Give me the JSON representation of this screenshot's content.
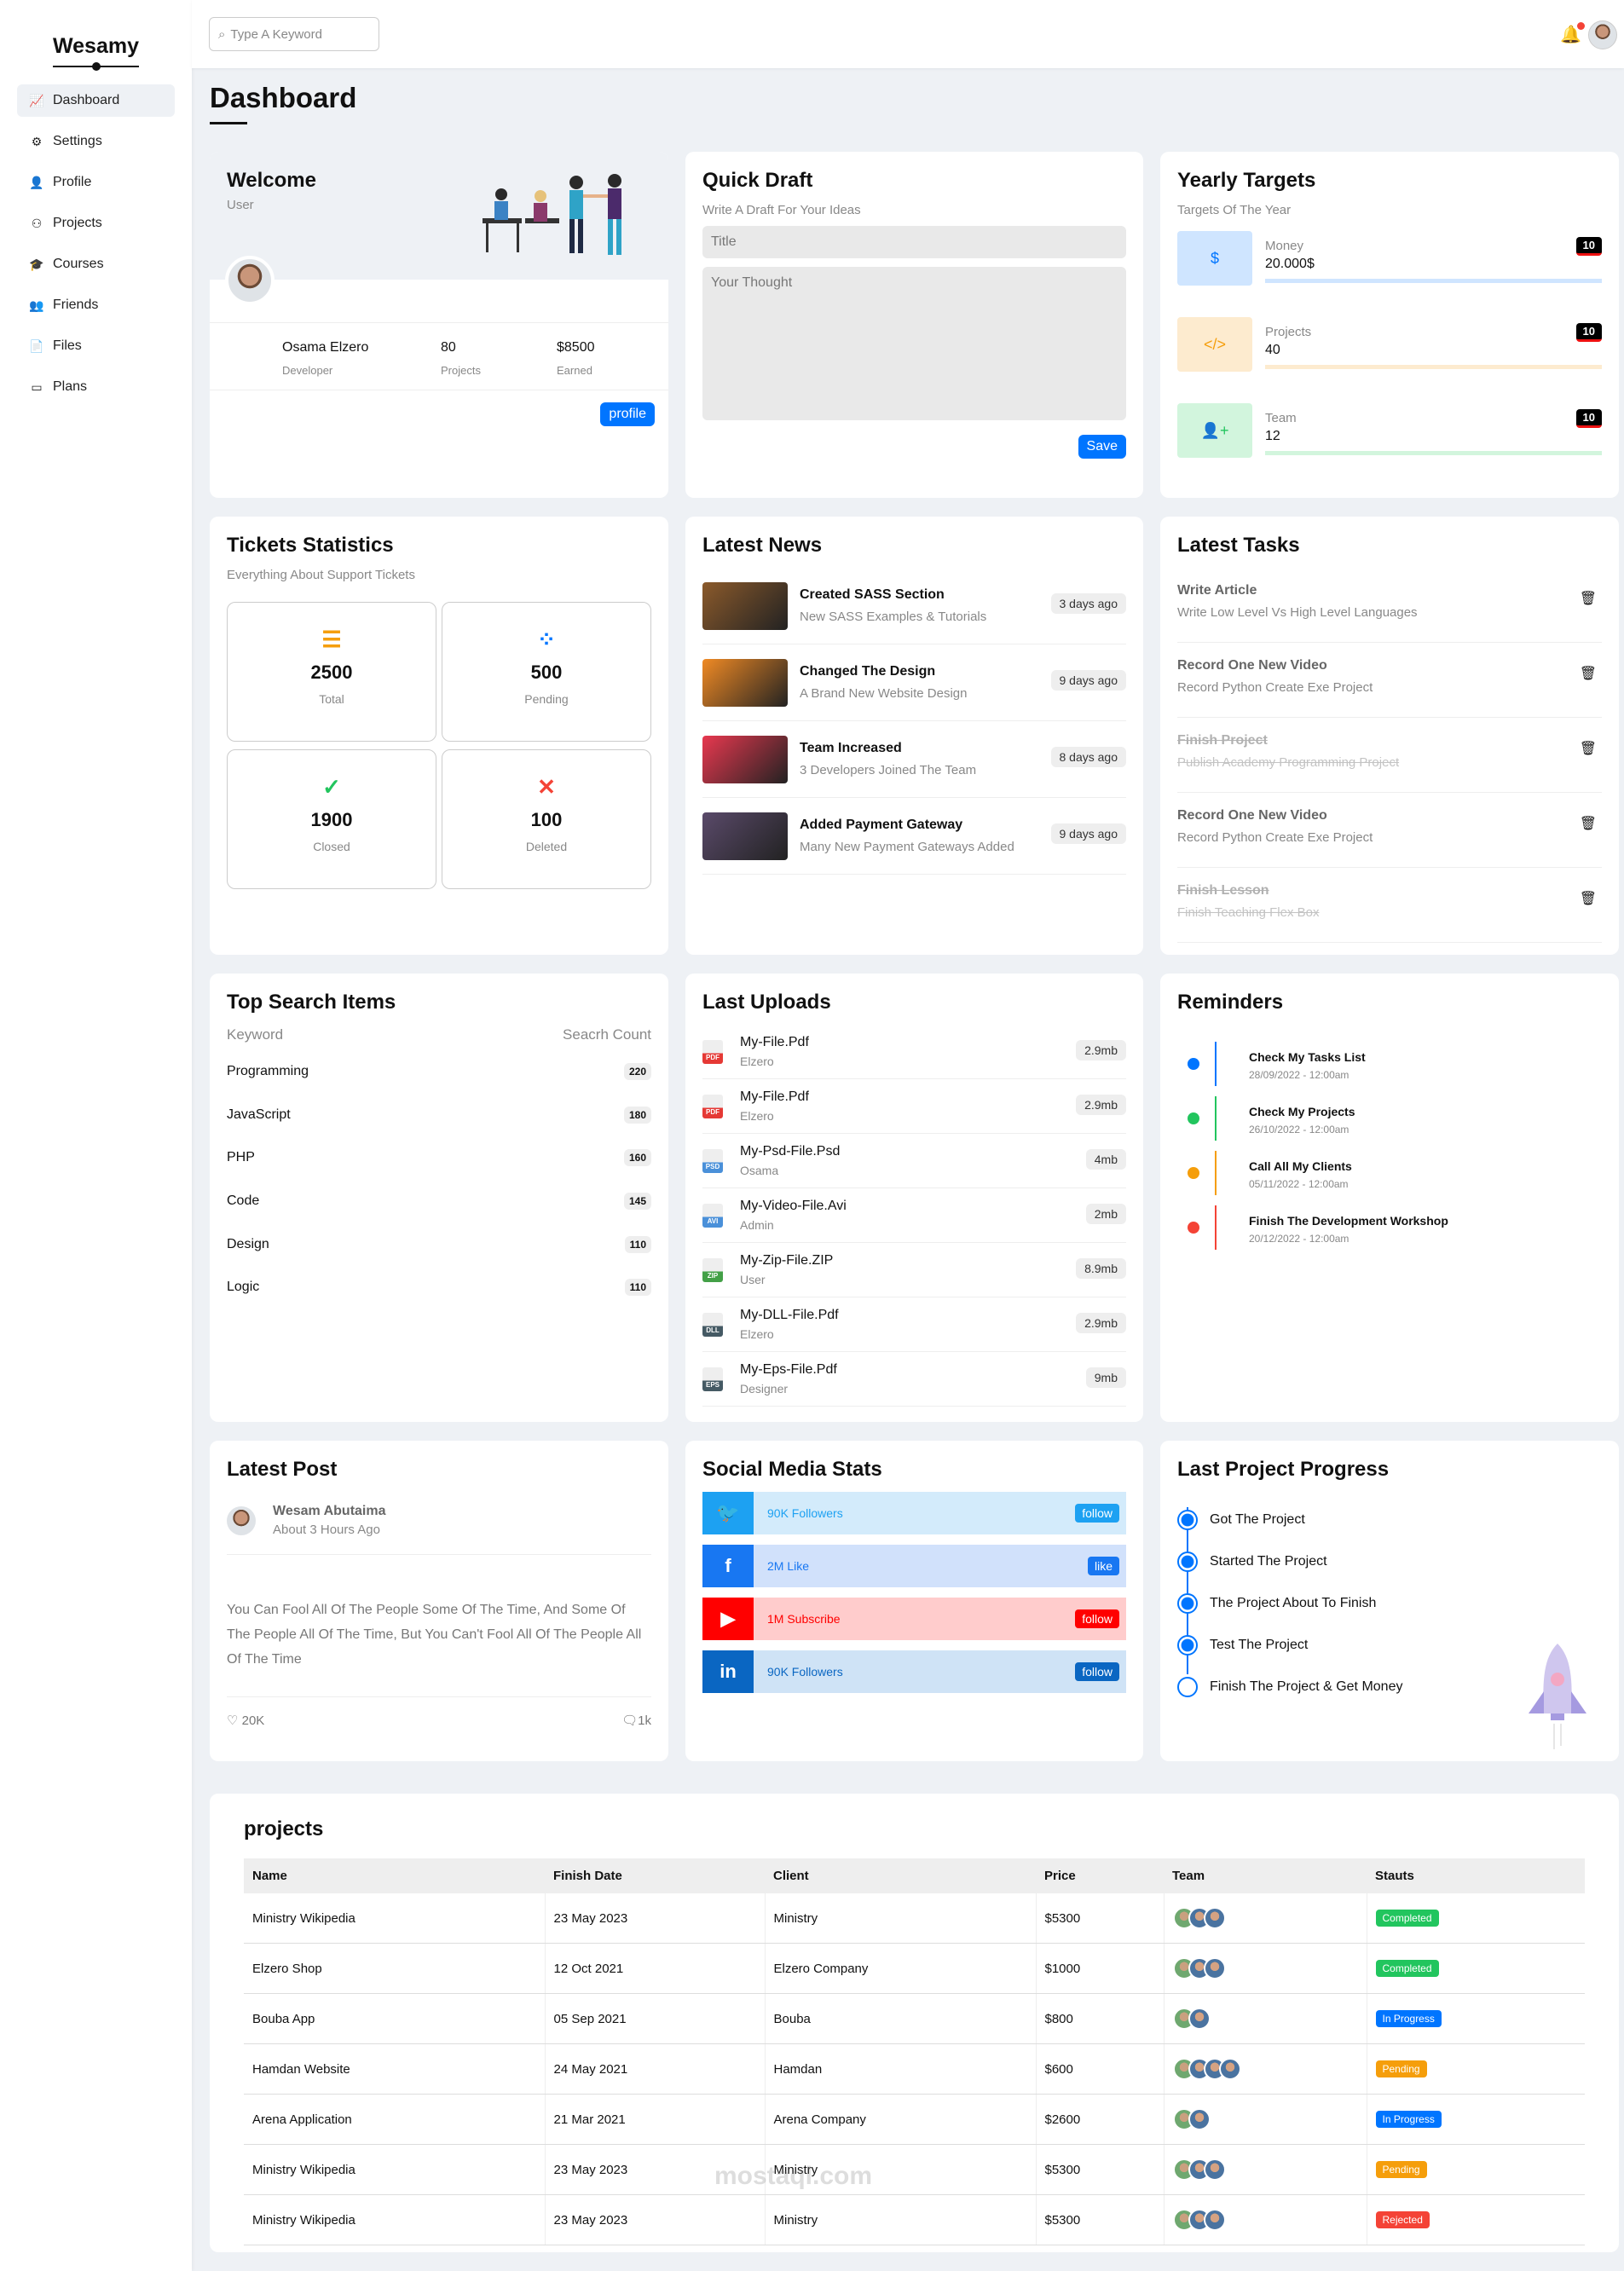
{
  "app": {
    "logo": "Wesamy"
  },
  "sidebar": {
    "items": [
      {
        "label": "Dashboard",
        "icon": "chart-line-icon"
      },
      {
        "label": "Settings",
        "icon": "gear-icon"
      },
      {
        "label": "Profile",
        "icon": "user-icon"
      },
      {
        "label": "Projects",
        "icon": "diagram-icon"
      },
      {
        "label": "Courses",
        "icon": "graduation-cap-icon"
      },
      {
        "label": "Friends",
        "icon": "users-icon"
      },
      {
        "label": "Files",
        "icon": "file-icon"
      },
      {
        "label": "Plans",
        "icon": "credit-card-icon"
      }
    ]
  },
  "topbar": {
    "search_placeholder": "Type A Keyword"
  },
  "page": {
    "title": "Dashboard"
  },
  "welcome": {
    "title": "Welcome",
    "subtitle": "User",
    "name": "Osama Elzero",
    "role": "Developer",
    "projects": "80",
    "projects_label": "Projects",
    "earned": "$8500",
    "earned_label": "Earned",
    "button": "profile"
  },
  "draft": {
    "title": "Quick Draft",
    "subtitle": "Write A Draft For Your Ideas",
    "title_placeholder": "Title",
    "body_placeholder": "Your Thought",
    "button": "Save"
  },
  "targets": {
    "title": "Yearly Targets",
    "subtitle": "Targets Of The Year",
    "items": [
      {
        "label": "Money",
        "value": "20.000$",
        "badge": "10",
        "color": "#0075ff",
        "bg": "#cfe5ff",
        "icon": "$"
      },
      {
        "label": "Projects",
        "value": "40",
        "badge": "10",
        "color": "#f59e0b",
        "bg": "#fdebcf",
        "icon": "</>"
      },
      {
        "label": "Team",
        "value": "12",
        "badge": "10",
        "color": "#22c55e",
        "bg": "#d2f5dd",
        "icon": "👤+"
      }
    ]
  },
  "tickets": {
    "title": "Tickets Statistics",
    "subtitle": "Everything About Support Tickets",
    "items": [
      {
        "value": "2500",
        "label": "Total",
        "color": "#f59e0b",
        "icon": "☰"
      },
      {
        "value": "500",
        "label": "Pending",
        "color": "#0075ff",
        "icon": "⁘"
      },
      {
        "value": "1900",
        "label": "Closed",
        "color": "#22c55e",
        "icon": "✓"
      },
      {
        "value": "100",
        "label": "Deleted",
        "color": "#f44336",
        "icon": "✕"
      }
    ]
  },
  "news": {
    "title": "Latest News",
    "items": [
      {
        "title": "Created SASS Section",
        "desc": "New SASS Examples & Tutorials",
        "time": "3 days ago",
        "color": "#8b5a2b"
      },
      {
        "title": "Changed The Design",
        "desc": "A Brand New Website Design",
        "time": "9 days ago",
        "color": "#f08a24"
      },
      {
        "title": "Team Increased",
        "desc": "3 Developers Joined The Team",
        "time": "8 days ago",
        "color": "#e8384f"
      },
      {
        "title": "Added Payment Gateway",
        "desc": "Many New Payment Gateways Added",
        "time": "9 days ago",
        "color": "#5a4a6a"
      }
    ]
  },
  "tasks": {
    "title": "Latest Tasks",
    "items": [
      {
        "title": "Write Article",
        "desc": "Write Low Level Vs High Level Languages",
        "done": false
      },
      {
        "title": "Record One New Video",
        "desc": "Record Python Create Exe Project",
        "done": false
      },
      {
        "title": "Finish Project",
        "desc": "Publish Academy Programming Project",
        "done": true
      },
      {
        "title": "Record One New Video",
        "desc": "Record Python Create Exe Project",
        "done": false
      },
      {
        "title": "Finish Lesson",
        "desc": "Finish Teaching Flex Box",
        "done": true
      }
    ]
  },
  "search_items": {
    "title": "Top Search Items",
    "col1": "Keyword",
    "col2": "Seacrh Count",
    "items": [
      {
        "k": "Programming",
        "c": "220"
      },
      {
        "k": "JavaScript",
        "c": "180"
      },
      {
        "k": "PHP",
        "c": "160"
      },
      {
        "k": "Code",
        "c": "145"
      },
      {
        "k": "Design",
        "c": "110"
      },
      {
        "k": "Logic",
        "c": "110"
      }
    ]
  },
  "uploads": {
    "title": "Last Uploads",
    "items": [
      {
        "name": "My-File.Pdf",
        "owner": "Elzero",
        "size": "2.9mb",
        "color": "#e53935",
        "ext": "PDF"
      },
      {
        "name": "My-File.Pdf",
        "owner": "Elzero",
        "size": "2.9mb",
        "color": "#e53935",
        "ext": "PDF"
      },
      {
        "name": "My-Psd-File.Psd",
        "owner": "Osama",
        "size": "4mb",
        "color": "#4a90d9",
        "ext": "PSD"
      },
      {
        "name": "My-Video-File.Avi",
        "owner": "Admin",
        "size": "2mb",
        "color": "#4a90d9",
        "ext": "AVI"
      },
      {
        "name": "My-Zip-File.ZIP",
        "owner": "User",
        "size": "8.9mb",
        "color": "#43a047",
        "ext": "ZIP"
      },
      {
        "name": "My-DLL-File.Pdf",
        "owner": "Elzero",
        "size": "2.9mb",
        "color": "#455a64",
        "ext": "DLL"
      },
      {
        "name": "My-Eps-File.Pdf",
        "owner": "Designer",
        "size": "9mb",
        "color": "#455a64",
        "ext": "EPS"
      }
    ]
  },
  "reminders": {
    "title": "Reminders",
    "items": [
      {
        "title": "Check My Tasks List",
        "date": "28/09/2022 - 12:00am",
        "color": "#0075ff"
      },
      {
        "title": "Check My Projects",
        "date": "26/10/2022 - 12:00am",
        "color": "#22c55e"
      },
      {
        "title": "Call All My Clients",
        "date": "05/11/2022 - 12:00am",
        "color": "#f59e0b"
      },
      {
        "title": "Finish The Development Workshop",
        "date": "20/12/2022 - 12:00am",
        "color": "#f44336"
      }
    ]
  },
  "post": {
    "title": "Latest Post",
    "author": "Wesam Abutaima",
    "time": "About 3 Hours Ago",
    "body": "You Can Fool All Of The People Some Of The Time, And Some Of The People All Of The Time, But You Can't Fool All Of The People All Of The Time",
    "likes": "20K",
    "comments": "1k"
  },
  "social": {
    "title": "Social Media Stats",
    "items": [
      {
        "text": "90K Followers",
        "btn": "follow",
        "color": "#1da1f2",
        "bg": "#d3ebfb",
        "icon": "twitter-icon",
        "glyph": "🐦"
      },
      {
        "text": "2M Like",
        "btn": "like",
        "color": "#1877f2",
        "bg": "#d1e1fb",
        "icon": "facebook-icon",
        "glyph": "f"
      },
      {
        "text": "1M Subscribe",
        "btn": "follow",
        "color": "#ff0000",
        "bg": "#ffcccc",
        "icon": "youtube-icon",
        "glyph": "▶"
      },
      {
        "text": "90K Followers",
        "btn": "follow",
        "color": "#0a66c2",
        "bg": "#cfe3f6",
        "icon": "linkedin-icon",
        "glyph": "in"
      }
    ]
  },
  "progress": {
    "title": "Last Project Progress",
    "steps": [
      {
        "label": "Got The Project",
        "done": true
      },
      {
        "label": "Started The Project",
        "done": true
      },
      {
        "label": "The Project About To Finish",
        "done": true
      },
      {
        "label": "Test The Project",
        "done": true
      },
      {
        "label": "Finish The Project & Get Money",
        "done": false
      }
    ]
  },
  "projects": {
    "title": "projects",
    "headers": [
      "Name",
      "Finish Date",
      "Client",
      "Price",
      "Team",
      "Stauts"
    ],
    "rows": [
      {
        "name": "Ministry Wikipedia",
        "date": "23 May 2023",
        "client": "Ministry",
        "price": "$5300",
        "team": 3,
        "status": "Completed",
        "color": "#22c55e"
      },
      {
        "name": "Elzero Shop",
        "date": "12 Oct 2021",
        "client": "Elzero Company",
        "price": "$1000",
        "team": 3,
        "status": "Completed",
        "color": "#22c55e"
      },
      {
        "name": "Bouba App",
        "date": "05 Sep 2021",
        "client": "Bouba",
        "price": "$800",
        "team": 2,
        "status": "In Progress",
        "color": "#0075ff"
      },
      {
        "name": "Hamdan Website",
        "date": "24 May 2021",
        "client": "Hamdan",
        "price": "$600",
        "team": 4,
        "status": "Pending",
        "color": "#f59e0b"
      },
      {
        "name": "Arena Application",
        "date": "21 Mar 2021",
        "client": "Arena Company",
        "price": "$2600",
        "team": 2,
        "status": "In Progress",
        "color": "#0075ff"
      },
      {
        "name": "Ministry Wikipedia",
        "date": "23 May 2023",
        "client": "Ministry",
        "price": "$5300",
        "team": 3,
        "status": "Pending",
        "color": "#f59e0b"
      },
      {
        "name": "Ministry Wikipedia",
        "date": "23 May 2023",
        "client": "Ministry",
        "price": "$5300",
        "team": 3,
        "status": "Rejected",
        "color": "#f44336"
      }
    ]
  },
  "watermark": {
    "text": "mostaql.com"
  }
}
